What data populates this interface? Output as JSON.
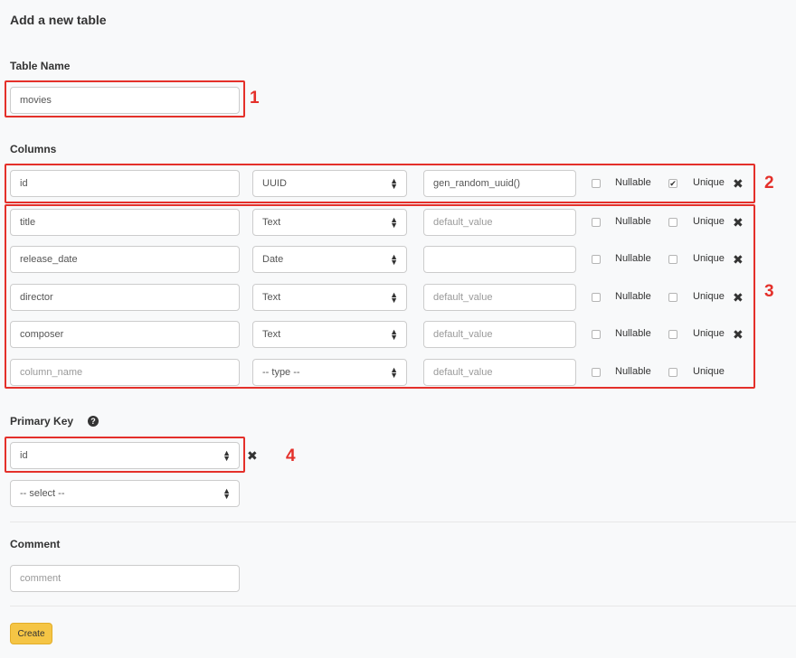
{
  "page": {
    "title": "Add a new table",
    "table_name_label": "Table Name",
    "table_name_value": "movies",
    "columns_label": "Columns",
    "primary_key_label": "Primary Key",
    "comment_label": "Comment",
    "comment_placeholder": "comment",
    "create_label": "Create"
  },
  "checkbox_labels": {
    "nullable": "Nullable",
    "unique": "Unique"
  },
  "columns": [
    {
      "name": "id",
      "type": "UUID",
      "default": "gen_random_uuid()",
      "default_placeholder": "default_value",
      "nullable": false,
      "unique": true,
      "removable": true
    },
    {
      "name": "title",
      "type": "Text",
      "default": "",
      "default_placeholder": "default_value",
      "nullable": false,
      "unique": false,
      "removable": true
    },
    {
      "name": "release_date",
      "type": "Date",
      "default": "",
      "default_placeholder": "",
      "nullable": false,
      "unique": false,
      "removable": true
    },
    {
      "name": "director",
      "type": "Text",
      "default": "",
      "default_placeholder": "default_value",
      "nullable": false,
      "unique": false,
      "removable": true
    },
    {
      "name": "composer",
      "type": "Text",
      "default": "",
      "default_placeholder": "default_value",
      "nullable": false,
      "unique": false,
      "removable": true
    },
    {
      "name": "",
      "name_placeholder": "column_name",
      "type": "-- type --",
      "default": "",
      "default_placeholder": "default_value",
      "nullable": false,
      "unique": false,
      "removable": false
    }
  ],
  "primary_keys": [
    {
      "value": "id",
      "removable": true
    },
    {
      "value": "-- select --",
      "removable": false
    }
  ],
  "annotations": [
    "1",
    "2",
    "3",
    "4"
  ],
  "icons": {
    "select_arrows": "updown-arrows-icon",
    "remove": "close-x-icon",
    "help": "question-circle-icon",
    "check": "checkmark-icon"
  },
  "colors": {
    "annotation": "#e4302a",
    "create_button": "#f5c545",
    "background": "#f8f9fa"
  }
}
